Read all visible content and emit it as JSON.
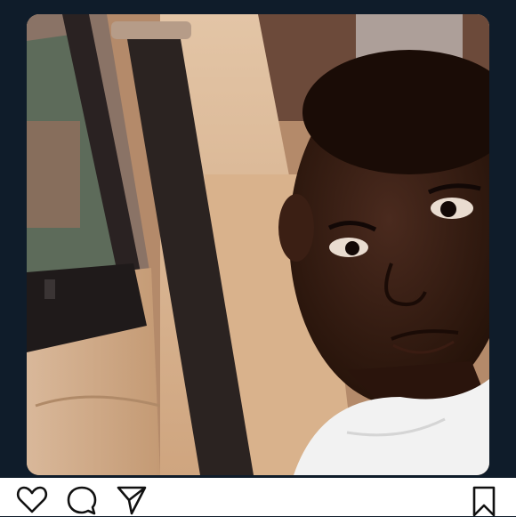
{
  "post": {
    "image_description_icon": "photo",
    "actions": {
      "like_icon": "heart-icon",
      "comment_icon": "comment-icon",
      "share_icon": "send-icon",
      "save_icon": "bookmark-icon"
    }
  },
  "colors": {
    "background": "#0f1c2a",
    "action_bar": "#ffffff",
    "icon_stroke": "#111111"
  }
}
